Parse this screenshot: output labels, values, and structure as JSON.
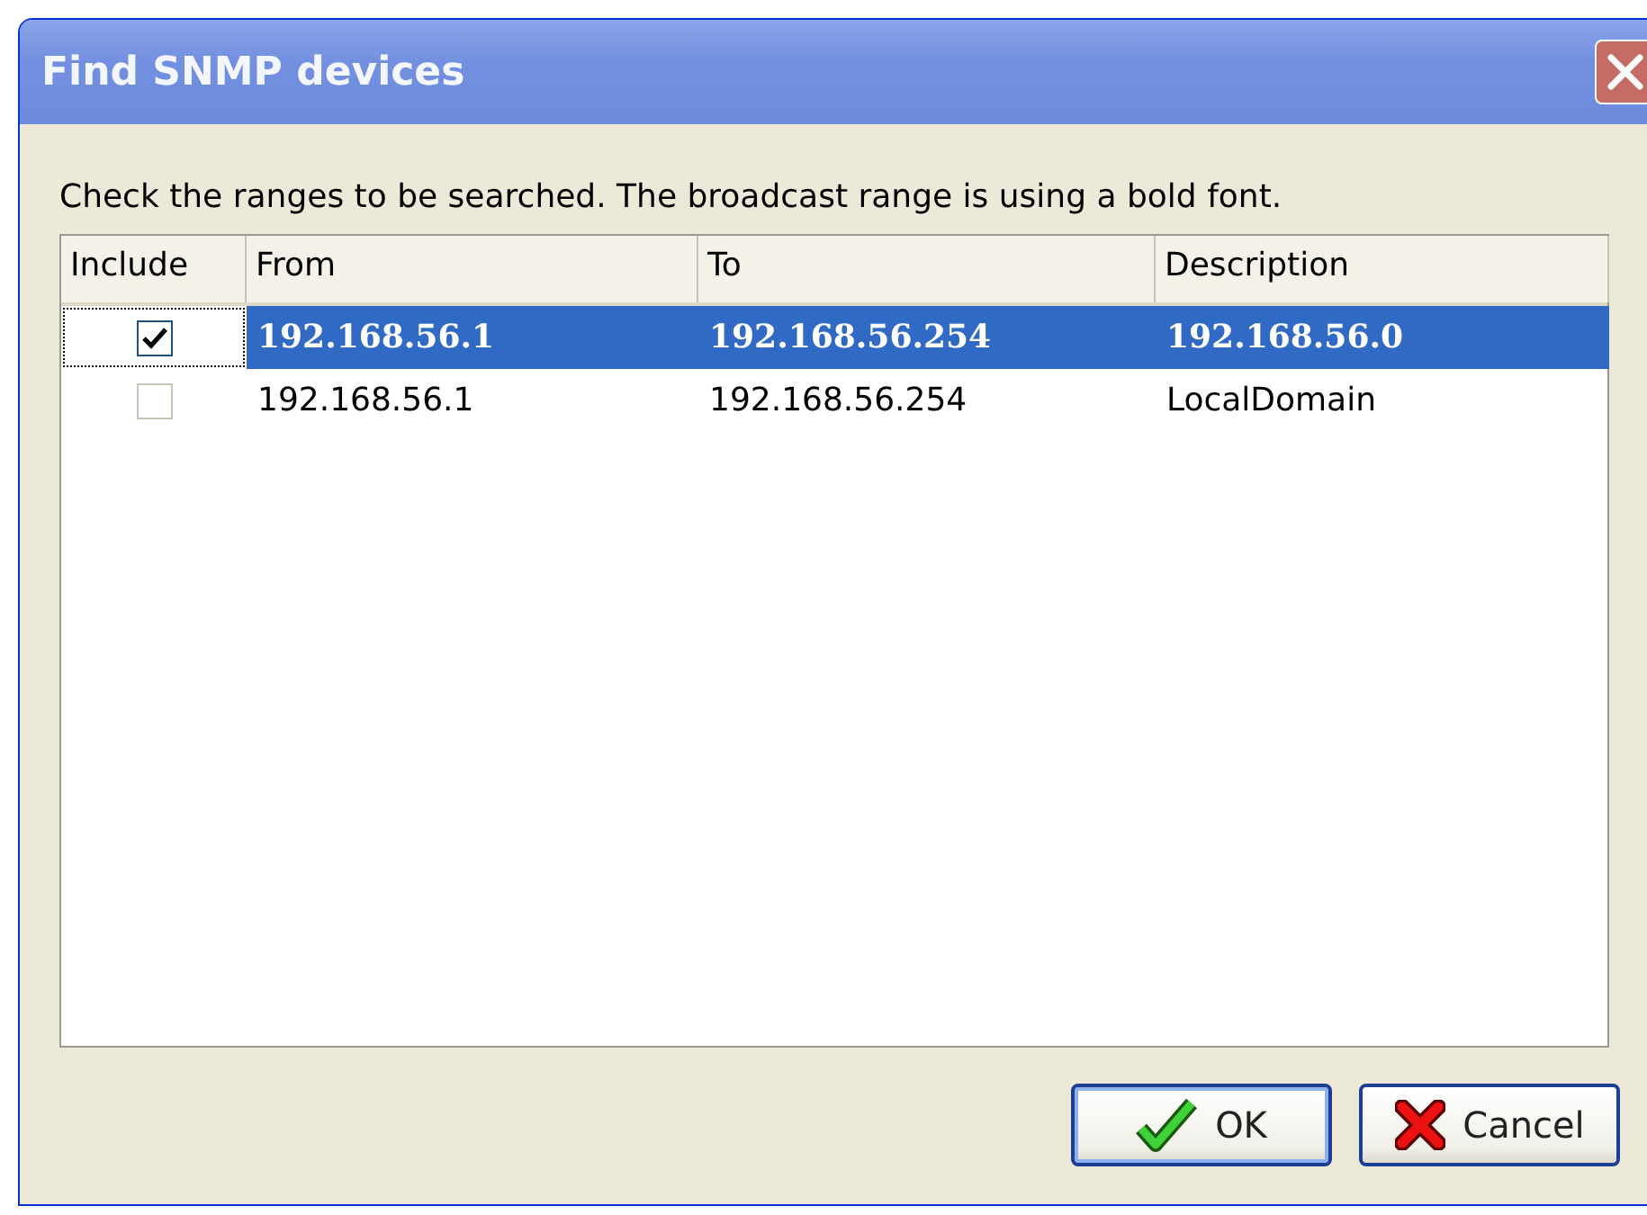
{
  "window": {
    "title": "Find SNMP devices"
  },
  "instruction": "Check the ranges to be searched. The broadcast range is using a bold font.",
  "table": {
    "columns": [
      "Include",
      "From",
      "To",
      "Description"
    ],
    "rows": [
      {
        "include": true,
        "selected": true,
        "bold": true,
        "from": "192.168.56.1",
        "to": "192.168.56.254",
        "description": "192.168.56.0"
      },
      {
        "include": false,
        "selected": false,
        "bold": false,
        "from": "192.168.56.1",
        "to": "192.168.56.254",
        "description": "LocalDomain"
      }
    ]
  },
  "buttons": [
    {
      "kind": "ok",
      "label": "OK"
    },
    {
      "kind": "cancel",
      "label": "Cancel"
    }
  ]
}
